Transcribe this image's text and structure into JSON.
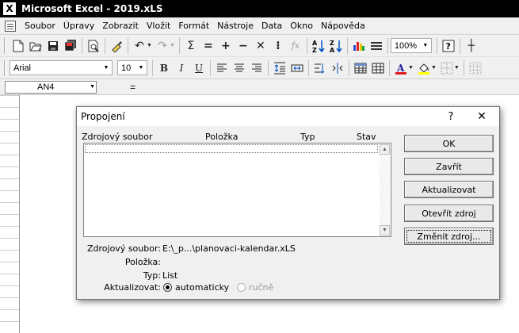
{
  "window": {
    "app_icon": "X",
    "title": "Microsoft Excel - 2019.xLS"
  },
  "menubar": {
    "items": [
      "Soubor",
      "Úpravy",
      "Zobrazit",
      "Vložit",
      "Formát",
      "Nástroje",
      "Data",
      "Okno",
      "Nápověda"
    ]
  },
  "toolbar_standard": {
    "icons": [
      "new-document-icon",
      "open-folder-icon",
      "save-icon",
      "save-all-icon",
      "print-preview-icon",
      "format-painter-icon",
      "undo-icon",
      "redo-icon",
      "autosum-icon",
      "equals-icon",
      "plus-icon",
      "minus-icon",
      "multiply-icon",
      "colon-icon",
      "function-icon",
      "sort-ascending-icon",
      "sort-descending-icon",
      "chart-wizard-icon",
      "drawing-icon",
      "help-icon",
      "crosshair-icon"
    ],
    "glyphs": {
      "sum": "Σ",
      "equals": "=",
      "plus": "+",
      "minus": "−",
      "multiply": "✕",
      "colon": "⁝",
      "fx": "fx",
      "sort_az": "A↓Z",
      "sort_za": "Z↓A",
      "help": "?",
      "crosshair": "┼",
      "undo": "↶",
      "redo": "↷"
    },
    "zoom": "100%"
  },
  "toolbar_format": {
    "font": "Arial",
    "size": "10",
    "bold": "B",
    "italic": "I",
    "underline": "U",
    "font_color_letter": "A",
    "accent_red": "#e01b1b",
    "accent_yellow": "#ffff00"
  },
  "formula_bar": {
    "name_box": "AN4",
    "equals": "="
  },
  "dialog": {
    "title": "Propojení",
    "help": "?",
    "close": "✕",
    "columns": [
      "Zdrojový soubor",
      "Položka",
      "Typ",
      "Stav"
    ],
    "buttons": [
      "OK",
      "Zavřít",
      "Aktualizovat",
      "Otevřít zdroj",
      "Změnit zdroj..."
    ],
    "info": {
      "source_label": "Zdrojový soubor:",
      "source_value": "E:\\_p...\\planovaci-kalendar.xLS",
      "item_label": "Položka:",
      "item_value": "",
      "type_label": "Typ:",
      "type_value": "List",
      "update_label": "Aktualizovat:"
    },
    "update_options": {
      "automatic": "automaticky",
      "manual": "ručně",
      "selected": "automatic"
    }
  }
}
